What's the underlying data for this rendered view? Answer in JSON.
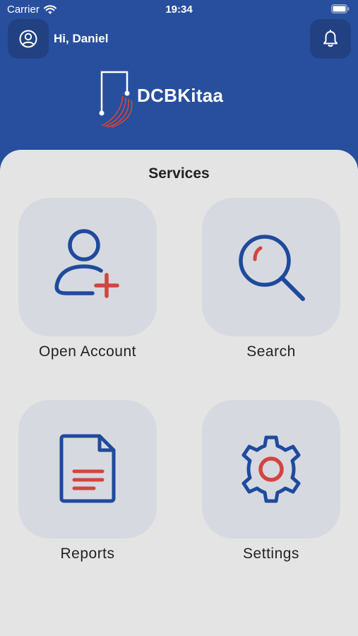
{
  "status_bar": {
    "carrier": "Carrier",
    "time": "19:34"
  },
  "header": {
    "greeting": "Hi, Daniel",
    "profile_icon": "user-circle-icon",
    "notification_icon": "bell-icon"
  },
  "logo": {
    "text": "DCBKitaa"
  },
  "services": {
    "title": "Services",
    "items": [
      {
        "label": "Open Account",
        "icon": "add-user-icon"
      },
      {
        "label": "Search",
        "icon": "search-icon"
      },
      {
        "label": "Reports",
        "icon": "document-icon"
      },
      {
        "label": "Settings",
        "icon": "gear-icon"
      }
    ]
  },
  "colors": {
    "brand_blue": "#284f9e",
    "icon_blue": "#1f4a9c",
    "accent_red": "#d2453e",
    "panel_bg": "#e4e4e4",
    "tile_bg": "#d6d9e0"
  }
}
